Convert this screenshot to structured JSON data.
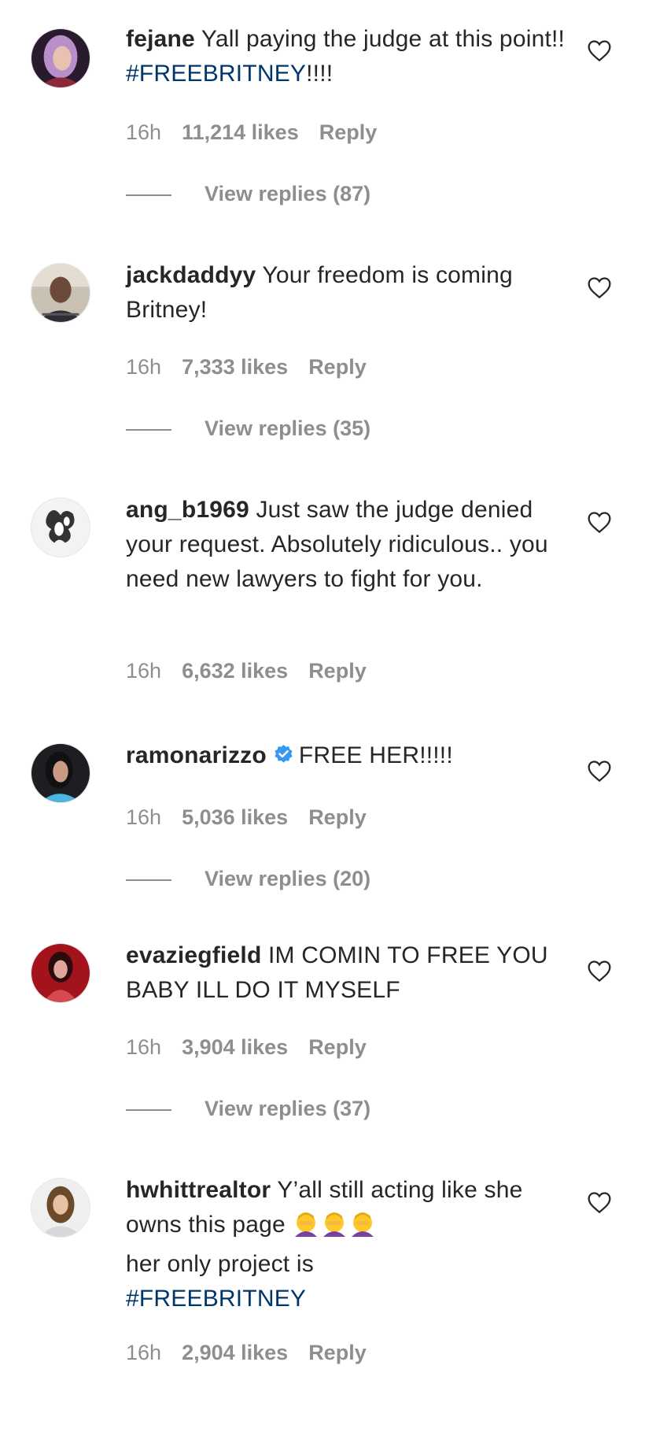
{
  "comments": [
    {
      "username": "fejane",
      "text": "Yall paying the judge at this point!! ",
      "hashtag": "#FREEBRITNEY",
      "text_after": "!!!!",
      "time": "16h",
      "likes": "11,214 likes",
      "reply": "Reply",
      "view_replies": "View replies (87)"
    },
    {
      "username": "jackdaddyy",
      "text": "Your freedom is coming Britney!",
      "time": "16h",
      "likes": "7,333 likes",
      "reply": "Reply",
      "view_replies": "View replies (35)"
    },
    {
      "username": "ang_b1969",
      "text": "Just saw the judge denied your request. Absolutely ridiculous.. you need new lawyers to fight for you.",
      "time": "16h",
      "likes": "6,632 likes",
      "reply": "Reply"
    },
    {
      "username": "ramonarizzo",
      "verified": true,
      "text": "FREE HER!!!!!",
      "time": "16h",
      "likes": "5,036 likes",
      "reply": "Reply",
      "view_replies": "View replies (20)"
    },
    {
      "username": "evaziegfield",
      "text": "IM COMIN TO FREE YOU BABY ILL DO IT MYSELF",
      "time": "16h",
      "likes": "3,904 likes",
      "reply": "Reply",
      "view_replies": "View replies (37)"
    },
    {
      "username": "hwhittrealtor",
      "text": "Y’all still acting like she owns this page",
      "emoji": "facepalm-woman-emoji x3",
      "text_after": "her only project is",
      "hashtag": "#FREEBRITNEY",
      "time": "16h",
      "likes": "2,904 likes",
      "reply": "Reply"
    }
  ],
  "colors": {
    "text": "#262626",
    "meta": "#8e8e8e",
    "hashtag": "#00376b",
    "verified": "#3897f0"
  }
}
